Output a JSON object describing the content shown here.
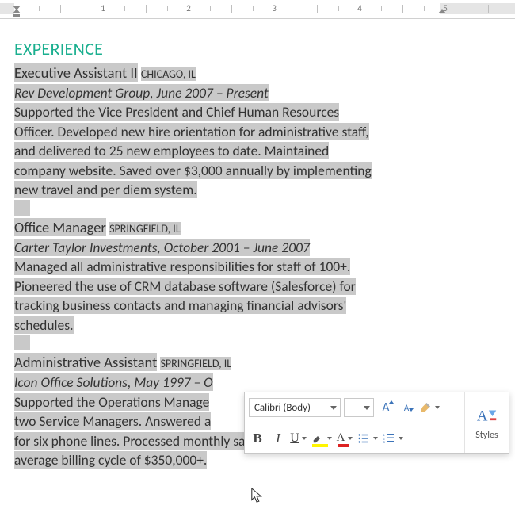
{
  "ruler": {
    "labels": [
      "1",
      "2",
      "3",
      "4",
      "5"
    ]
  },
  "heading": "EXPERIENCE",
  "jobs": [
    {
      "title": "Executive Assistant II",
      "location": "CHICAGO, IL",
      "company": "Rev Development Group, June 2007 – Present",
      "l1": "Supported the Vice President and Chief Human Resources",
      "l2": "Officer. Developed new hire orientation for administrative staff,",
      "l3": "and delivered to 25 new employees to date. Maintained",
      "l4": "company website. Saved over $3,000 annually by implementing",
      "l5": "new travel and per diem system."
    },
    {
      "title": "Office Manager",
      "location": "SPRINGFIELD, IL",
      "company": "Carter Taylor Investments, October 2001 – June 2007",
      "l1": "Managed all administrative responsibilities for staff of 100+.",
      "l2": "Pioneered the use of CRM database software (Salesforce) for",
      "l3": "tracking business contacts and managing financial advisors'",
      "l4": "schedules."
    },
    {
      "title": "Administrative Assistant",
      "location": "SPRINGFIELD, IL",
      "company_a": "Icon Office Solutions, May 1997 – O",
      "l1a": "Supported the Operations Manage",
      "l2a": "two Service Managers. Answered a",
      "l3": "for six phone lines. Processed monthly sales bills for an",
      "l4": "average billing cycle of $350,000+."
    }
  ],
  "toolbar": {
    "font": "Calibri (Body)",
    "size": "",
    "styles_label": "Styles",
    "bold": "B",
    "italic": "I",
    "underline": "U",
    "grow": "A",
    "shrink": "A",
    "fontcolor": "A"
  }
}
